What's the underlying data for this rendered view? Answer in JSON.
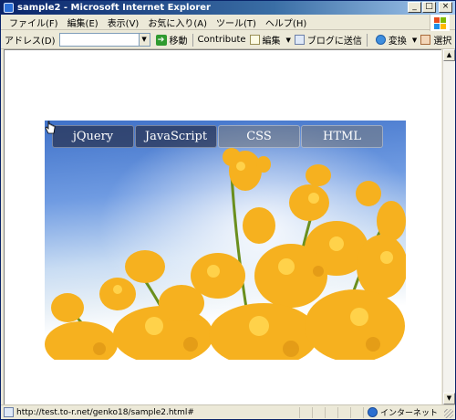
{
  "window": {
    "title": "sample2 - Microsoft Internet Explorer",
    "buttons": {
      "minimize": "_",
      "maximize": "□",
      "close": "×"
    }
  },
  "menubar": {
    "items": [
      {
        "label": "ファイル(F)"
      },
      {
        "label": "編集(E)"
      },
      {
        "label": "表示(V)"
      },
      {
        "label": "お気に入り(A)"
      },
      {
        "label": "ツール(T)"
      },
      {
        "label": "ヘルプ(H)"
      }
    ]
  },
  "addressbar": {
    "label": "アドレス(D)",
    "value": "",
    "go_label": "移動",
    "contribute": "Contribute",
    "edit_label": "編集",
    "blog_label": "ブログに送信",
    "convert_label": "変換",
    "select_label": "選択"
  },
  "page": {
    "nav_tabs": [
      {
        "label": "jQuery",
        "state": "dark"
      },
      {
        "label": "JavaScript",
        "state": "dark"
      },
      {
        "label": "CSS",
        "state": "light"
      },
      {
        "label": "HTML",
        "state": "light"
      }
    ]
  },
  "statusbar": {
    "url": "http://test.to-r.net/genko18/sample2.html#",
    "zone": "インターネット"
  },
  "colors": {
    "titlebar_start": "#0a246a",
    "titlebar_end": "#a6caf0",
    "chrome": "#ece9d8",
    "tab_dark": "#283250",
    "tab_light": "#787878",
    "flower_yellow": "#f6b11f"
  }
}
